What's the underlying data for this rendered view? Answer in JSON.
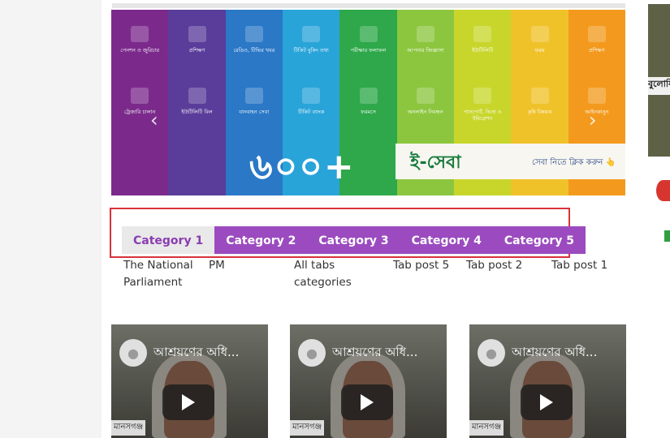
{
  "banner": {
    "colors": [
      "#7b2a8c",
      "#5a3d9a",
      "#2a78c6",
      "#29a4d9",
      "#2ea84a",
      "#8cc63f",
      "#c8d62c",
      "#f0c22a",
      "#f39a1e"
    ],
    "row1": [
      {
        "icon": "megaphone-icon",
        "label": "পেনশন ও জুরিচার"
      },
      {
        "icon": "laptop-icon",
        "label": "প্রশিক্ষণ"
      },
      {
        "icon": "tv-icon",
        "label": "রেডিও, টিভির খবর"
      },
      {
        "icon": "train-icon",
        "label": "টিকিট বুকিং তথ্য"
      },
      {
        "icon": "graduation-icon",
        "label": "পরীক্ষার ফলাফল"
      },
      {
        "icon": "chat-icon",
        "label": "আপনার জিজ্ঞাসা"
      },
      {
        "icon": "bill-icon",
        "label": "ইউটিলিটি"
      },
      {
        "icon": "scale-icon",
        "label": "ফরম"
      },
      {
        "icon": "gesture-icon",
        "label": "প্রশিক্ষণ"
      }
    ],
    "row2": [
      {
        "icon": "card-icon",
        "label": "ট্রেজারি চালান"
      },
      {
        "icon": "phone-icon",
        "label": "ইউটিলিটি বিল"
      },
      {
        "icon": "city-icon",
        "label": "যানবাহন সেবা"
      },
      {
        "icon": "vaccine-icon",
        "label": "টিকিট ব্যাংক"
      },
      {
        "icon": "document-icon",
        "label": "ফরমসে"
      },
      {
        "icon": "hand-icon",
        "label": "অনলাইন নিবন্ধন"
      },
      {
        "icon": "passport-icon",
        "label": "পাসপোর্ট, ভিসা ও ইমিগ্রেশন"
      },
      {
        "icon": "gear-icon",
        "label": "কৃষি বিষয়ক"
      },
      {
        "icon": "news-icon",
        "label": "আইনকানুন"
      }
    ],
    "prev_arrow": "‹",
    "next_arrow": "›",
    "big_text": "৬০০+",
    "eseba_title": "ই-সেবা",
    "eseba_click": "সেবা নিতে ক্লিক করুন 👆"
  },
  "tabs": [
    {
      "label": "Category 1",
      "active": true
    },
    {
      "label": "Category 2",
      "active": false
    },
    {
      "label": "Category 3",
      "active": false
    },
    {
      "label": "Category 4",
      "active": false
    },
    {
      "label": "Category 5",
      "active": false
    }
  ],
  "posts": [
    "The National Parliament",
    "PM",
    "All tabs categories",
    "Tab post 5",
    "Tab post 2",
    "Tab post 1"
  ],
  "videos": [
    {
      "title": "আশ্রয়ণের অধি...",
      "logo": "মানসগঞ্জ"
    },
    {
      "title": "আশ্রয়ণের অধি...",
      "logo": "মানসগঞ্জ"
    },
    {
      "title": "আশ্রয়ণের অধি...",
      "logo": "মানসগঞ্জ"
    }
  ],
  "right_image_text": "বুলোষি"
}
